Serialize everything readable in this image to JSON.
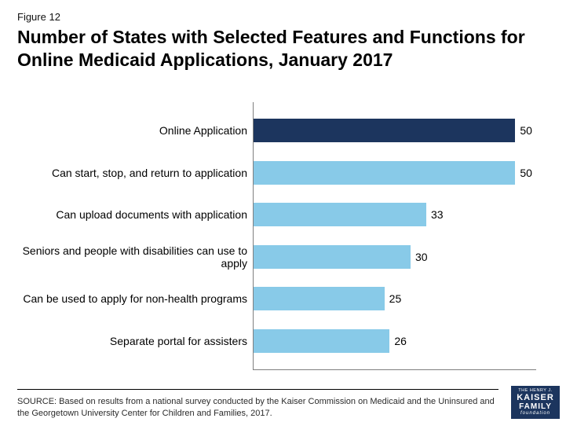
{
  "figure_label": "Figure 12",
  "title": "Number of States with Selected Features and Functions for Online Medicaid Applications, January 2017",
  "source": "SOURCE: Based on results from a national survey conducted by the Kaiser Commission on Medicaid and the Uninsured and the Georgetown University Center for Children and Families, 2017.",
  "logo": {
    "line1": "THE HENRY J.",
    "line2": "KAISER",
    "line3": "FAMILY",
    "line4": "foundation"
  },
  "chart_data": {
    "type": "bar",
    "orientation": "horizontal",
    "xlabel": "",
    "ylabel": "",
    "xlim": [
      0,
      54
    ],
    "categories": [
      "Online Application",
      "Can start, stop, and return to application",
      "Can upload documents with application",
      "Seniors and people with disabilities can use to apply",
      "Can be used to apply for non-health programs",
      "Separate portal for assisters"
    ],
    "values": [
      50,
      50,
      33,
      30,
      25,
      26
    ],
    "highlight_index": 0,
    "colors": {
      "default": "#88cae8",
      "highlight": "#1c355e"
    }
  }
}
